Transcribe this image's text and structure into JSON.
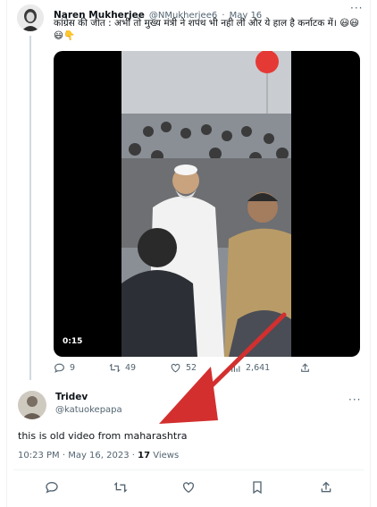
{
  "tweet": {
    "author_name": "Naren Mukherjee",
    "handle": "@NMukherjee6",
    "date": "May 16",
    "text": "कांग्रेस की जीत : अभी तो मुख्य मंत्री ने शपथ भी नही ली और ये हाल है कर्नाटक में। 😃😃😃👇",
    "video_duration": "0:15",
    "stats": {
      "replies": "9",
      "retweets": "49",
      "likes": "52",
      "views": "2,641"
    }
  },
  "reply": {
    "author_name": "Tridev",
    "handle": "@katuokepapa",
    "text": "this is old video from maharashtra",
    "timestamp": "10:23 PM · May 16, 2023 · ",
    "views_count": "17",
    "views_label": " Views"
  },
  "icons": [
    "reply-icon",
    "retweet-icon",
    "like-icon",
    "views-icon",
    "share-icon",
    "bookmark-icon",
    "more-icon"
  ],
  "colors": {
    "muted": "#536471",
    "arrow": "#d32f2f",
    "text": "#0f1419"
  }
}
